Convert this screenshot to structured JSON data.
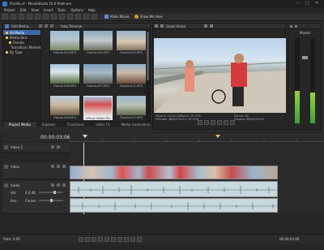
{
  "window": {
    "title": "Florida.vf - MovieStudio 16.0 Platinum",
    "controls": {
      "min": "—",
      "max": "□",
      "close": "✕"
    }
  },
  "menu": [
    "Project",
    "Edit",
    "View",
    "Insert",
    "Tools",
    "Options",
    "Help"
  ],
  "toolbar": {
    "make_movie": "Make Movie",
    "show_me_how": "Show Me How"
  },
  "media": {
    "add_media": "Add Media...",
    "auto_preview": "Auto Preview",
    "tree": [
      {
        "label": "All Media",
        "selected": true
      },
      {
        "label": "Media Bins",
        "selected": false
      },
      {
        "label": "Florida",
        "selected": false
      },
      {
        "label": "Transitions Marked",
        "selected": false
      },
      {
        "label": "By Type",
        "selected": false
      }
    ],
    "thumbs": [
      {
        "caption": "Florida-004.MTS"
      },
      {
        "caption": "Florida-005.MTS"
      },
      {
        "caption": "Florida-006.MTS"
      },
      {
        "caption": "Florida-007.MTS"
      },
      {
        "caption": "Florida-008.MTS"
      },
      {
        "caption": "Florida-009.MTS"
      },
      {
        "caption": "Florida-010.MTS"
      },
      {
        "caption": "Florida-011.MTS"
      },
      {
        "caption": "Florida-012.MTS"
      }
    ],
    "selected_caption": "Official Media File",
    "tabs": [
      "Project Media",
      "Explorer",
      "Transitions",
      "Video FX",
      "Media Generators"
    ]
  },
  "preview": {
    "mode": "Good (Auto)",
    "project_label": "Project:",
    "project_value": "1920x1080x32, 29.970i",
    "preview_label": "Preview:",
    "preview_value": "480x270x32, 29.970i",
    "frame_label": "Frame:",
    "frame_value": "95",
    "display_label": "Display:",
    "display_value": "469x275x32"
  },
  "master": {
    "label": "Master"
  },
  "timeline": {
    "timecode": "00:00:03;06",
    "tracks": [
      {
        "name": "Video 2"
      },
      {
        "name": "Video"
      },
      {
        "name": "Audio"
      }
    ],
    "audio_vol": "Vol:",
    "audio_vol_value": "0.0 dB",
    "audio_pan": "Pan:",
    "audio_pan_value": "Center",
    "rate": "Rate: 0.00",
    "status_right": "00:00:03;06"
  }
}
